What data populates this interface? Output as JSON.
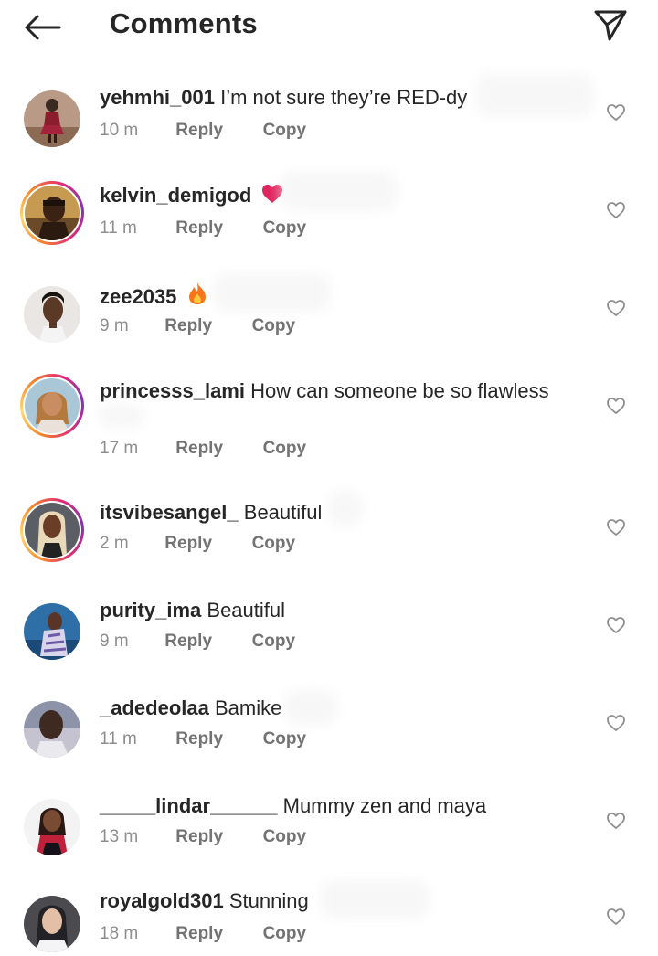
{
  "header": {
    "title": "Comments",
    "back_icon": "arrow-left-icon",
    "send_icon": "paper-plane-icon"
  },
  "colors": {
    "text": "#262626",
    "meta": "#8e8e8e",
    "story_ring_start": "#f58529",
    "story_ring_end": "#dd2a7b",
    "heart_emoji": "#e0245e",
    "fire_emoji": "#f7741a"
  },
  "comments": [
    {
      "username": "yehmhi_001",
      "text": "I’m not sure they’re RED-dy",
      "emoji": "",
      "time": "10 m",
      "reply": "Reply",
      "copy": "Copy",
      "story": false
    },
    {
      "username": "kelvin_demigod",
      "text": "",
      "emoji": "heart-emoji",
      "time": "11 m",
      "reply": "Reply",
      "copy": "Copy",
      "story": true
    },
    {
      "username": "zee2035",
      "text": "",
      "emoji": "fire-emoji",
      "time": "9 m",
      "reply": "Reply",
      "copy": "Copy",
      "story": false
    },
    {
      "username": "princesss_lami",
      "text": "How can someone be so flawless",
      "emoji": "",
      "time": "17 m",
      "reply": "Reply",
      "copy": "Copy",
      "story": true
    },
    {
      "username": "itsvibesangel_",
      "text": "Beautiful",
      "emoji": "",
      "time": "2 m",
      "reply": "Reply",
      "copy": "Copy",
      "story": true
    },
    {
      "username": "purity_ima",
      "text": "Beautiful",
      "emoji": "",
      "time": "9 m",
      "reply": "Reply",
      "copy": "Copy",
      "story": false
    },
    {
      "username": "_adedeolaa",
      "text": "Bamike",
      "emoji": "",
      "time": "11 m",
      "reply": "Reply",
      "copy": "Copy",
      "story": false
    },
    {
      "username": "_____lindar______",
      "text": "Mummy zen and maya",
      "emoji": "",
      "time": "13 m",
      "reply": "Reply",
      "copy": "Copy",
      "story": false
    },
    {
      "username": "royalgold301",
      "text": "Stunning",
      "emoji": "",
      "time": "18 m",
      "reply": "Reply",
      "copy": "Copy",
      "story": false
    }
  ]
}
